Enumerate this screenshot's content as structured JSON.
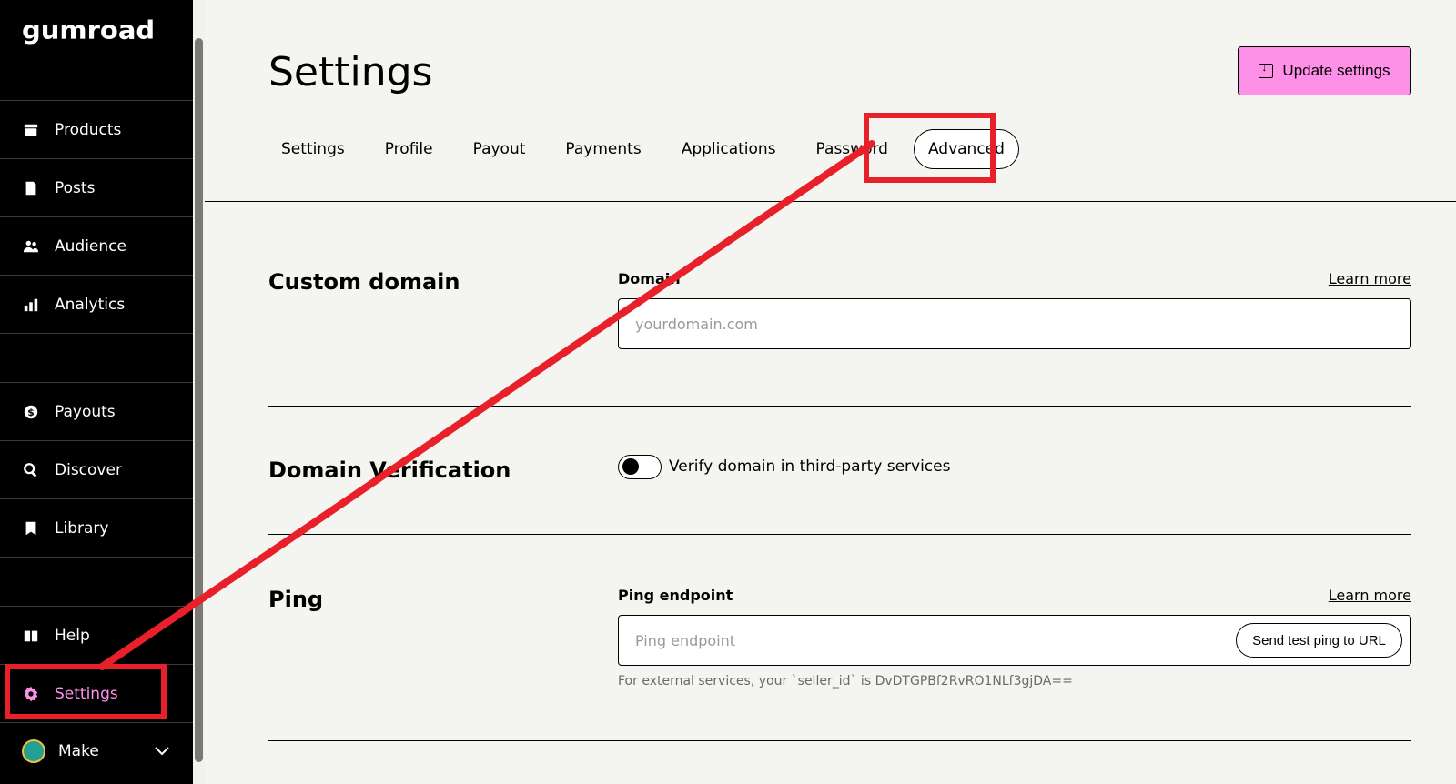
{
  "app": {
    "logo": "GUMROAD"
  },
  "sidebar": {
    "items": [
      {
        "label": "Products",
        "icon": "archive-icon"
      },
      {
        "label": "Posts",
        "icon": "document-icon"
      },
      {
        "label": "Audience",
        "icon": "people-icon"
      },
      {
        "label": "Analytics",
        "icon": "bar-chart-icon"
      },
      {
        "label": "Payouts",
        "icon": "dollar-icon"
      },
      {
        "label": "Discover",
        "icon": "search-icon"
      },
      {
        "label": "Library",
        "icon": "bookmark-icon"
      },
      {
        "label": "Help",
        "icon": "book-icon"
      },
      {
        "label": "Settings",
        "icon": "gear-icon",
        "active": true
      }
    ],
    "account": {
      "name": "Make"
    }
  },
  "header": {
    "title": "Settings",
    "update_button": "Update settings"
  },
  "tabs": [
    "Settings",
    "Profile",
    "Payout",
    "Payments",
    "Applications",
    "Password",
    "Advanced"
  ],
  "selected_tab": "Advanced",
  "sections": {
    "custom_domain": {
      "title": "Custom domain",
      "field_label": "Domain",
      "learn_more": "Learn more",
      "placeholder": "yourdomain.com"
    },
    "domain_verification": {
      "title": "Domain Verification",
      "toggle_label": "Verify domain in third-party services"
    },
    "ping": {
      "title": "Ping",
      "field_label": "Ping endpoint",
      "learn_more": "Learn more",
      "placeholder": "Ping endpoint",
      "test_button": "Send test ping to URL",
      "help_text": "For external services, your `seller_id` is DvDTGPBf2RvRO1NLf3gjDA=="
    }
  },
  "colors": {
    "accent": "#ff90e8",
    "annotation": "#e8202a"
  }
}
